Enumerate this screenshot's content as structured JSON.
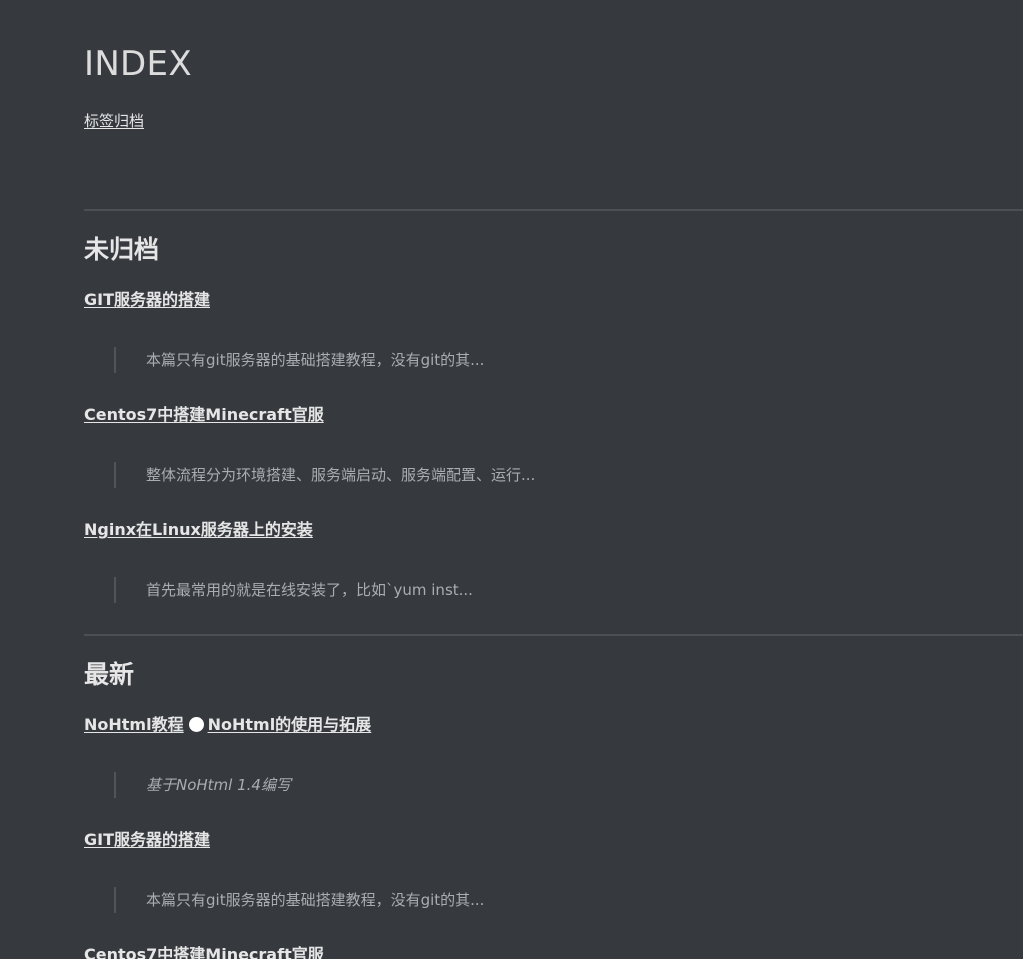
{
  "site": {
    "title": "INDEX",
    "nav_link": "标签归档"
  },
  "sections": [
    {
      "title": "未归档",
      "posts": [
        {
          "title": "GIT服务器的搭建",
          "excerpt": "本篇只有git服务器的基础搭建教程，没有git的其..."
        },
        {
          "title": "Centos7中搭建Minecraft官服",
          "excerpt": "整体流程分为环境搭建、服务端启动、服务端配置、运行..."
        },
        {
          "title": "Nginx在Linux服务器上的安装",
          "excerpt": "首先最常用的就是在线安装了，比如`yum inst..."
        }
      ]
    },
    {
      "title": "最新",
      "posts": [
        {
          "title_part1": "NoHtml教程",
          "title_part2": "NoHtml的使用与拓展",
          "excerpt": "基于NoHtml 1.4编写"
        },
        {
          "title": "GIT服务器的搭建",
          "excerpt": "本篇只有git服务器的基础搭建教程，没有git的其..."
        },
        {
          "title": "Centos7中搭建Minecraft官服"
        }
      ]
    }
  ]
}
